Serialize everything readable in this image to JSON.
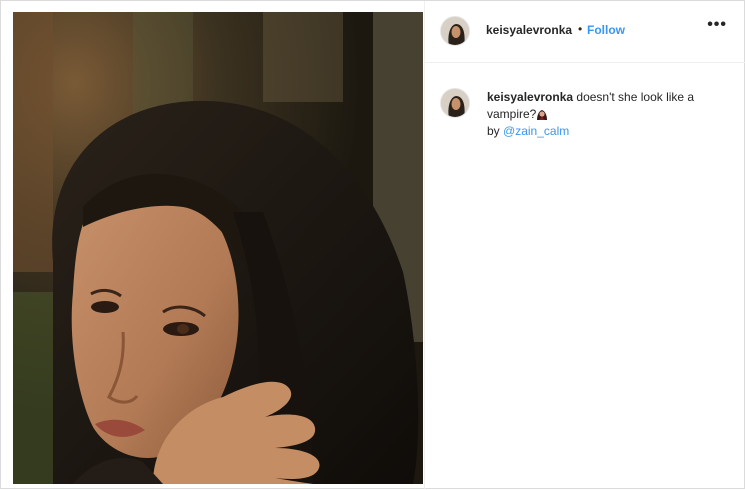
{
  "post": {
    "username": "keisyalevronka",
    "separator": "•",
    "follow_label": "Follow",
    "more_icon": "more-options-icon",
    "more_label": "•••"
  },
  "caption": {
    "username": "keisyalevronka",
    "text": "doesn't she look like a vampire?",
    "emoji": "vampire-woman-emoji",
    "by_label": "by",
    "mention": "@zain_calm"
  },
  "colors": {
    "link_blue": "#3897f0",
    "text": "#262626",
    "border": "#dbdbdb"
  }
}
